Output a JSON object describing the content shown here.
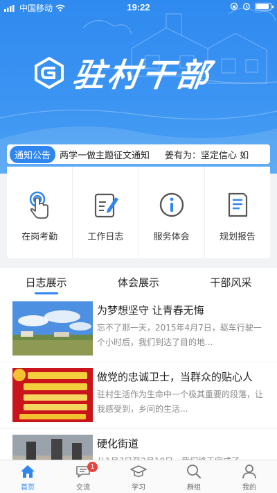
{
  "status_bar": {
    "carrier": "中国移动",
    "time": "19:22"
  },
  "brand": {
    "title": "驻村干部"
  },
  "notice": {
    "badge": "通知公告",
    "items": [
      "两学一做主题征文通知",
      "姜有为：坚定信心 如"
    ]
  },
  "actions": [
    {
      "label": "在岗考勤",
      "icon": "touch-icon"
    },
    {
      "label": "工作日志",
      "icon": "edit-note-icon"
    },
    {
      "label": "服务体会",
      "icon": "info-icon"
    },
    {
      "label": "规划报告",
      "icon": "document-icon"
    }
  ],
  "tabs": [
    {
      "label": "日志展示",
      "active": true
    },
    {
      "label": "体会展示",
      "active": false
    },
    {
      "label": "干部风采",
      "active": false
    }
  ],
  "feed": [
    {
      "title": "为梦想坚守 让青春无悔",
      "desc": "忘不了那一天，2015年4月7日，驱车行驶一个小时后，我们到达了目的地..."
    },
    {
      "title": "做党的忠诚卫士，当群众的贴心人",
      "desc": "驻村生活作为生命中一个极其重要的段落，让我感受到，乡间的生活..."
    },
    {
      "title": "硬化街道",
      "desc": "从1月7日至2月10日，我们终于完成了"
    }
  ],
  "bottom_nav": [
    {
      "label": "首页",
      "icon": "home-icon",
      "active": true
    },
    {
      "label": "交流",
      "icon": "chat-icon",
      "badge": "1"
    },
    {
      "label": "学习",
      "icon": "graduation-cap-icon"
    },
    {
      "label": "群组",
      "icon": "search-icon"
    },
    {
      "label": "我的",
      "icon": "user-icon"
    }
  ],
  "colors": {
    "primary": "#2f86ee",
    "badge_red": "#e8433e"
  }
}
